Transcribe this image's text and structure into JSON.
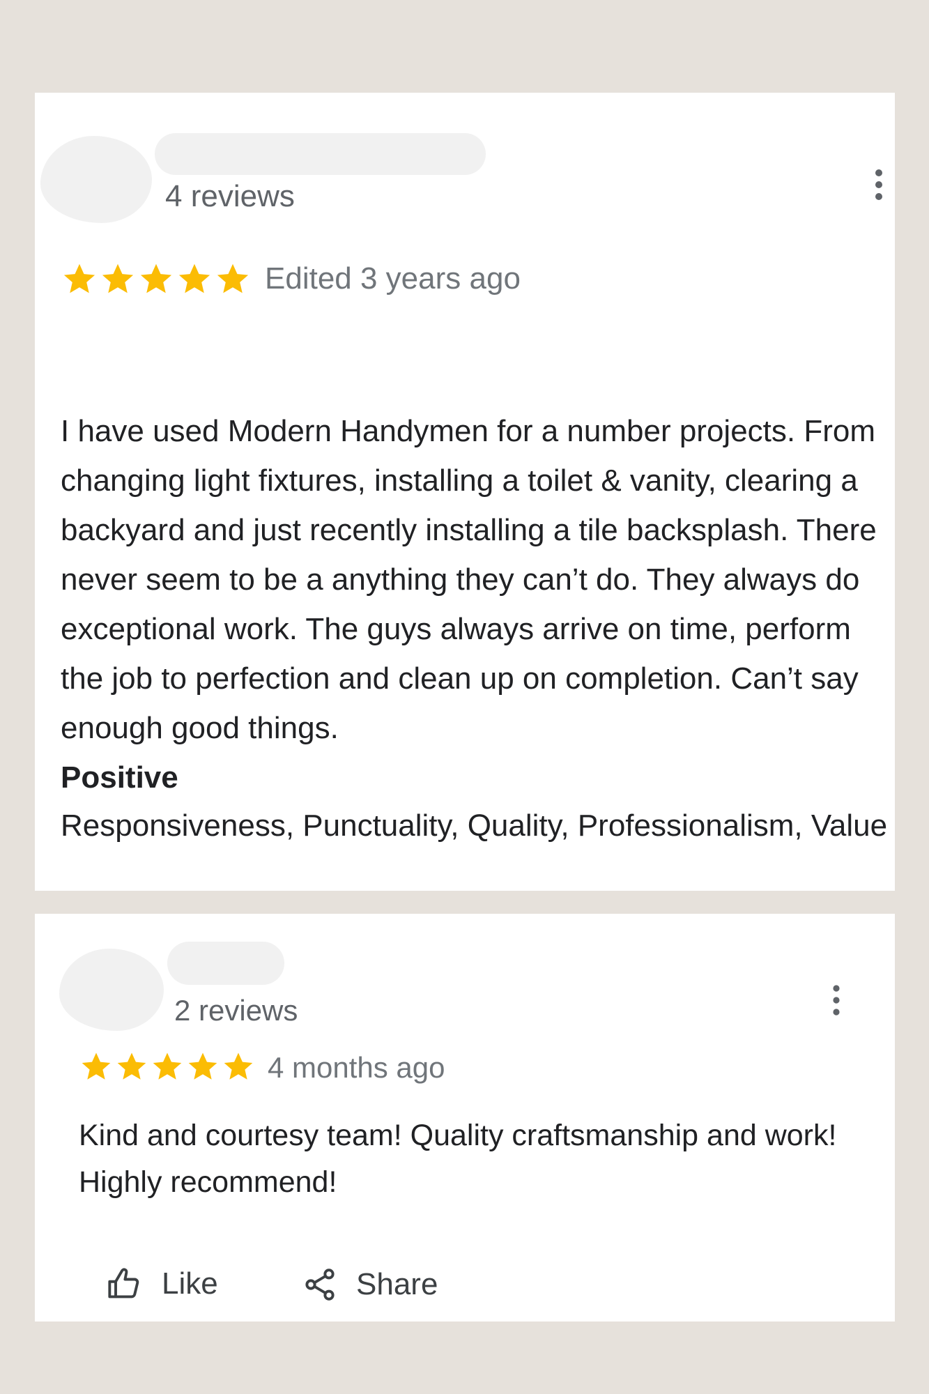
{
  "reviews": [
    {
      "reviewer_reviews": "4 reviews",
      "rating": 5,
      "date": "Edited 3 years ago",
      "text": "I have used Modern Handymen for a number projects. From changing light fixtures, installing a toilet & vanity, clearing a backyard and just recently installing a tile backsplash. There never seem to be a anything they can’t do. They always do exceptional work. The guys always arrive on time, perform the job to perfection and clean up on completion. Can’t say enough good things.",
      "attributes_heading": "Positive",
      "attributes": "Responsiveness, Punctuality, Quality, Professionalism, Value"
    },
    {
      "reviewer_reviews": "2 reviews",
      "rating": 5,
      "date": "4 months ago",
      "text": "Kind and courtesy team! Quality craftsmanship and work! Highly recommend!"
    }
  ],
  "actions": {
    "like_label": "Like",
    "share_label": "Share"
  },
  "icons": {
    "star": "star-icon",
    "more": "more-vertical-icon",
    "like": "thumbs-up-icon",
    "share": "share-icon"
  },
  "colors": {
    "star": "#fbbc04",
    "background": "#e6e1db",
    "card": "#ffffff"
  }
}
